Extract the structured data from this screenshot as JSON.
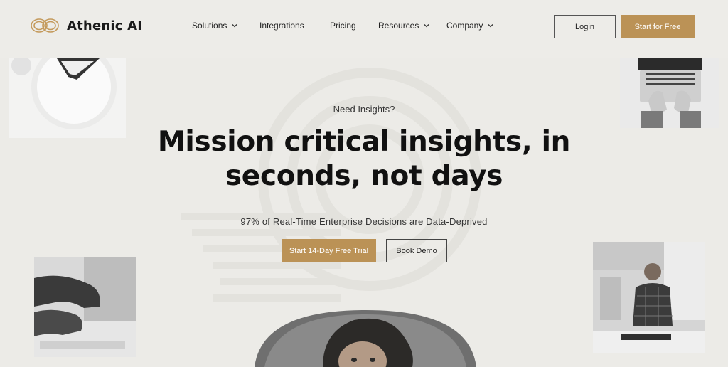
{
  "brand": {
    "name": "Athenic AI",
    "accent": "#bb9256"
  },
  "nav": {
    "items": [
      {
        "label": "Solutions",
        "has_dropdown": true
      },
      {
        "label": "Integrations",
        "has_dropdown": false
      },
      {
        "label": "Pricing",
        "has_dropdown": false
      },
      {
        "label": "Resources",
        "has_dropdown": true
      },
      {
        "label": "Company",
        "has_dropdown": true
      }
    ],
    "login_label": "Login",
    "start_label": "Start for Free"
  },
  "hero": {
    "eyebrow": "Need Insights?",
    "headline_line1": "Mission critical insights, in",
    "headline_line2": "seconds, not days",
    "subtitle": "97% of Real-Time Enterprise Decisions are Data-Deprived",
    "trial_label": "Start 14-Day Free Trial",
    "demo_label": "Book Demo"
  },
  "images": {
    "top_left": "desk-with-glasses-photo",
    "top_right": "laptop-typing-photo",
    "bottom_left": "hand-on-keyboard-photo",
    "bottom_right": "man-in-office-photo",
    "bottom_center": "woman-portrait-photo"
  }
}
